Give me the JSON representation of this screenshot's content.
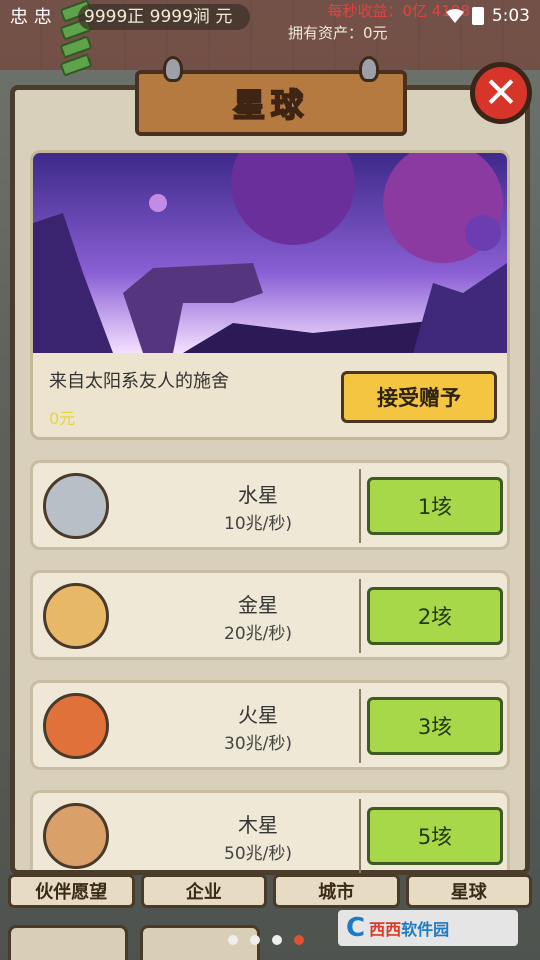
{
  "status_bar": {
    "left_text": "忠 忠",
    "time": "5:03"
  },
  "header": {
    "money_text": "9999正 9999涧 元",
    "assets_label": "拥有资产：0元",
    "top_right_partial": "每秒收益：0亿 4108"
  },
  "modal": {
    "title": "星球",
    "close_icon": "close-x-icon"
  },
  "feature": {
    "description": "来自太阳系友人的施舍",
    "price": "0元",
    "accept_label": "接受赠予"
  },
  "planets": [
    {
      "name": "水星",
      "rate": "10兆/秒)",
      "price": "1垓",
      "color": "#b9bfc6"
    },
    {
      "name": "金星",
      "rate": "20兆/秒)",
      "price": "2垓",
      "color": "#e7b868"
    },
    {
      "name": "火星",
      "rate": "30兆/秒)",
      "price": "3垓",
      "color": "#e0713a"
    },
    {
      "name": "木星",
      "rate": "50兆/秒)",
      "price": "5垓",
      "color": "#d9a06a"
    }
  ],
  "tabs": [
    "伙伴愿望",
    "企业",
    "城市",
    "星球"
  ],
  "watermark": {
    "prefix": "C",
    "brand": "西西",
    "suffix": "软件园"
  },
  "pager": {
    "count": 4,
    "active": 4
  }
}
